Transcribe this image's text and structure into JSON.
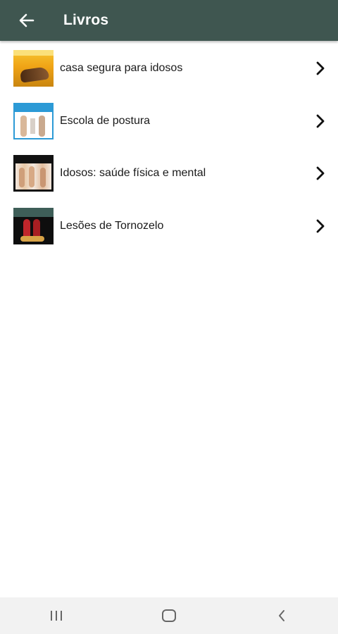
{
  "appbar": {
    "title": "Livros",
    "back_icon": "arrow-left-icon",
    "background": "#3f5650"
  },
  "books": [
    {
      "title": "casa segura para idosos",
      "cover": "book-cover-casa-segura"
    },
    {
      "title": "Escola de postura",
      "cover": "book-cover-escola-postura"
    },
    {
      "title": "Idosos: saúde física e mental",
      "cover": "book-cover-idosos"
    },
    {
      "title": "Lesões de Tornozelo",
      "cover": "book-cover-tornozelo"
    }
  ],
  "row_action_icon": "chevron-right-icon",
  "system_nav": {
    "recents_icon": "recents-icon",
    "home_icon": "home-icon",
    "back_icon": "back-icon"
  }
}
